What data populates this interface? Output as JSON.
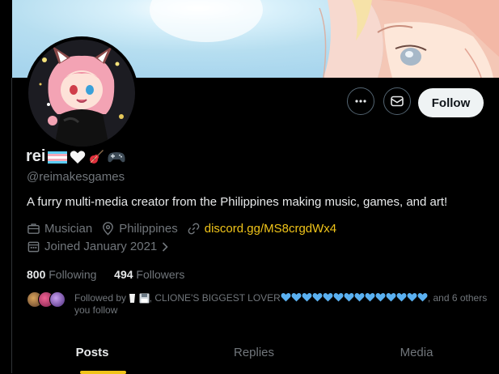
{
  "header": {
    "banner": "banner-art",
    "avatar": "profile-avatar"
  },
  "actions": {
    "more_icon": "more-icon",
    "message_icon": "mail-icon",
    "follow_label": "Follow"
  },
  "profile": {
    "display_name": "rei",
    "name_emojis": [
      "transgender-flag",
      "white-heart",
      "guitar",
      "game-controller"
    ],
    "handle": "@reimakesgames",
    "bio": "A furry multi-media creator from the Philippines making music, games, and art!",
    "profession": "Musician",
    "location": "Philippines",
    "website": "discord.gg/MS8crgdWx4",
    "joined": "Joined January 2021"
  },
  "stats": {
    "following_count": "800",
    "following_label": "Following",
    "followers_count": "494",
    "followers_label": "Followers"
  },
  "followed_by": {
    "prefix": "Followed by",
    "name_part": ", CLIONE'S BIGGEST LOVER",
    "suffix": ", and 6 others you follow",
    "heart_color": "#5ab0f0",
    "heart_count": 14
  },
  "tabs": [
    {
      "label": "Posts",
      "active": true
    },
    {
      "label": "Replies",
      "active": false
    },
    {
      "label": "Media",
      "active": false
    }
  ],
  "colors": {
    "background": "#000000",
    "accent": "#f0c419",
    "muted": "#71767b",
    "text": "#e7e9ea"
  }
}
